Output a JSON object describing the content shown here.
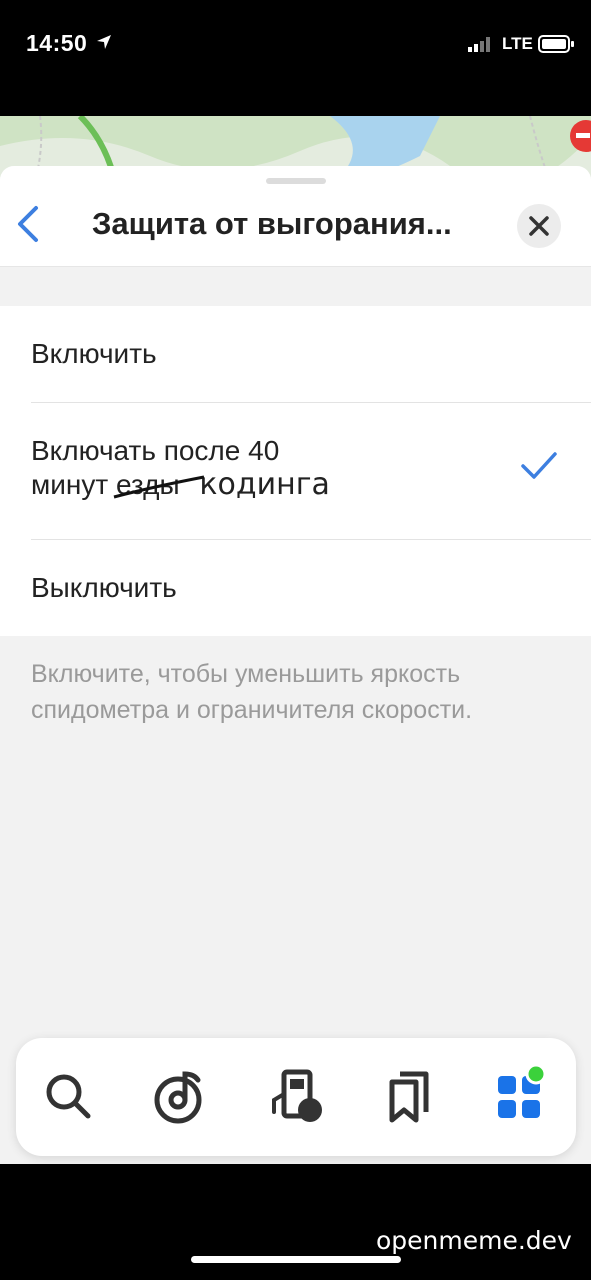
{
  "status_bar": {
    "time": "14:50",
    "network": "LTE"
  },
  "header": {
    "title": "Защита от выгорания..."
  },
  "options": [
    {
      "label": "Включить",
      "selected": false
    },
    {
      "label_line1": "Включать после 40",
      "label_line2_prefix": "минут",
      "struck_word": "езды",
      "handwritten_word": "кодинга",
      "selected": true
    },
    {
      "label": "Выключить",
      "selected": false
    }
  ],
  "description": "Включите, чтобы уменьшить яркость спидометра и ограничителя скорости.",
  "tabbar": {
    "items": [
      "search-icon",
      "music-icon",
      "fuel-icon",
      "bookmarks-icon",
      "services-icon"
    ],
    "accent": "#1a73e8",
    "badge_color": "#3bd13b"
  },
  "watermark": "openmeme.dev"
}
